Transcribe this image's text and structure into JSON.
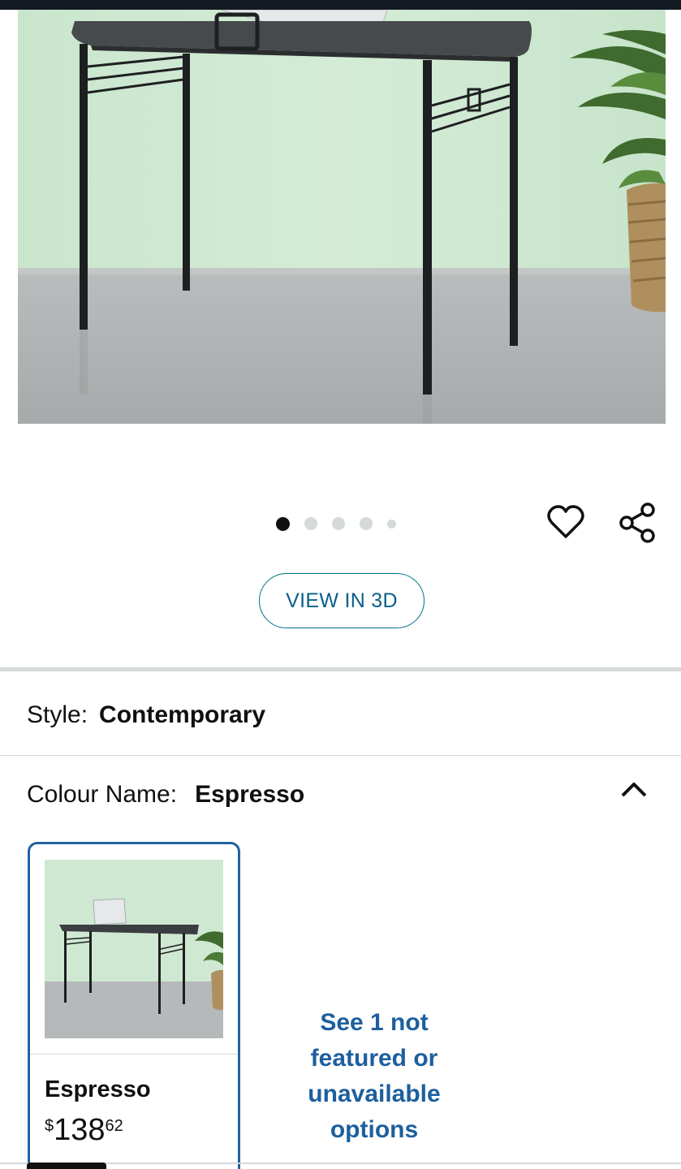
{
  "gallery": {
    "dot_count": 5,
    "active_index": 0
  },
  "actions": {
    "view_3d_label": "VIEW IN 3D"
  },
  "style": {
    "label": "Style:",
    "value": "Contemporary"
  },
  "colour": {
    "label": "Colour Name:",
    "value": "Espresso"
  },
  "swatch": {
    "name": "Espresso",
    "price_symbol": "$",
    "price_whole": "138",
    "price_fraction": "62"
  },
  "more_options": {
    "label": "See 1 not featured or unavailable options"
  },
  "colors": {
    "accent_blue": "#2162a1",
    "link_teal": "#007185",
    "top_bar": "#131a22"
  }
}
